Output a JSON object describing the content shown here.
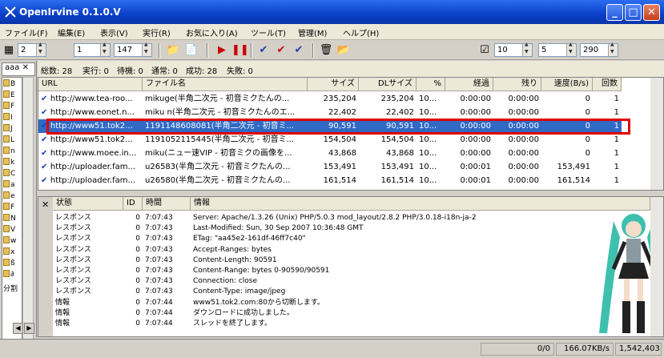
{
  "window": {
    "title": "OpenIrvine 0.1.0.V"
  },
  "menu": [
    "ファイル(F)",
    "編集(E)",
    "表示(V)",
    "実行(R)",
    "お気に入り(A)",
    "ツール(T)",
    "管理(M)",
    "ヘルプ(H)"
  ],
  "toolbar": {
    "spin1": "2",
    "spin2": "1",
    "spin3": "147",
    "spin4": "10",
    "spin5": "5",
    "spin6": "290"
  },
  "left": {
    "tab_label": "aaa",
    "bottom_label": "分割"
  },
  "stats": {
    "total": "総数: 28",
    "running": "実行: 0",
    "waiting": "待機: 0",
    "normal": "通常: 0",
    "success": "成功: 28",
    "failed": "失敗: 0"
  },
  "grid": {
    "headers": [
      "URL",
      "ファイル名",
      "サイズ",
      "DLサイズ",
      "%",
      "経過",
      "残り",
      "速度(B/s)",
      "回数"
    ],
    "rows": [
      [
        "http://www.tea-roo...",
        "mikuge(半角二次元 - 初音ミクたんの...",
        "235,204",
        "235,204",
        "10...",
        "0:00:00",
        "0:00:00",
        "0",
        "1"
      ],
      [
        "http://www.eonet.n...",
        "miku n(半角二次元 - 初音ミクたんのエ...",
        "22,402",
        "22,402",
        "10...",
        "0:00:00",
        "0:00:00",
        "0",
        "1"
      ],
      [
        "http://www51.tok2...",
        "1191148608081(半角二次元 - 初音ミ...",
        "90,591",
        "90,591",
        "10...",
        "0:00:00",
        "0:00:00",
        "0",
        "1"
      ],
      [
        "http://www51.tok2...",
        "1191052115445(半角二次元 - 初音ミ...",
        "154,504",
        "154,504",
        "10...",
        "0:00:00",
        "0:00:00",
        "0",
        "1"
      ],
      [
        "http://www.moee.in...",
        "miku(ニュー速VIP - 初音ミクの画像を...",
        "43,868",
        "43,868",
        "10...",
        "0:00:00",
        "0:00:00",
        "0",
        "1"
      ],
      [
        "http://uploader.fam...",
        "u26583(半角二次元 - 初音ミクたんの...",
        "153,491",
        "153,491",
        "10...",
        "0:00:01",
        "0:00:00",
        "153,491",
        "1"
      ],
      [
        "http://uploader.fam...",
        "u26580(半角二次元 - 初音ミクたんの...",
        "161,514",
        "161,514",
        "10...",
        "0:00:01",
        "0:00:00",
        "161,514",
        "1"
      ]
    ],
    "selected_row": 2
  },
  "log": {
    "headers": [
      "状態",
      "ID",
      "時間",
      "情報"
    ],
    "rows": [
      [
        "レスポンス",
        "0",
        "7:07:43",
        "Server: Apache/1.3.26 (Unix) PHP/5.0.3 mod_layout/2.8.2 PHP/3.0.18-i18n-ja-2"
      ],
      [
        "レスポンス",
        "0",
        "7:07:43",
        "Last-Modified: Sun, 30 Sep 2007 10:36:48 GMT"
      ],
      [
        "レスポンス",
        "0",
        "7:07:43",
        "ETag: \"aa45e2-161df-46ff7c40\""
      ],
      [
        "レスポンス",
        "0",
        "7:07:43",
        "Accept-Ranges: bytes"
      ],
      [
        "レスポンス",
        "0",
        "7:07:43",
        "Content-Length: 90591"
      ],
      [
        "レスポンス",
        "0",
        "7:07:43",
        "Content-Range: bytes 0-90590/90591"
      ],
      [
        "レスポンス",
        "0",
        "7:07:43",
        "Connection: close"
      ],
      [
        "レスポンス",
        "0",
        "7:07:43",
        "Content-Type: image/jpeg"
      ],
      [
        "情報",
        "0",
        "7:07:44",
        "www51.tok2.com:80から切断します。"
      ],
      [
        "情報",
        "0",
        "7:07:44",
        "ダウンロードに成功しました。"
      ],
      [
        "情報",
        "0",
        "7:07:44",
        "スレッドを終了します。"
      ]
    ]
  },
  "status": {
    "count": "0/0",
    "speed": "166.07KB/s",
    "total": "1,542,403"
  },
  "colors": {
    "titlebar": "#0a3fc8",
    "selection": "#316ac5",
    "highlight_box": "#e00000"
  }
}
